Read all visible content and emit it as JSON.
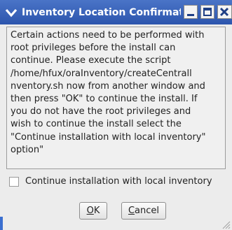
{
  "window": {
    "title": "Inventory Location Confirmatio"
  },
  "message": {
    "text": "Certain actions need to be performed with\nroot privileges before the install can\ncontinue. Please execute the script\n/home/hfux/oraInventory/createCentrall\nnventory.sh now from another window and\nthen press \"OK\" to continue the install. If\nyou do not have the root privileges and\nwish to continue the install select the\n\"Continue installation with local inventory\"\noption\""
  },
  "checkbox": {
    "label": "Continue installation with local inventory",
    "checked": false
  },
  "buttons": {
    "ok_mnemonic": "O",
    "ok_rest": "K",
    "cancel_mnemonic": "C",
    "cancel_rest": "ancel"
  },
  "icons": {
    "window_menu": "chevron-down-icon",
    "minimize": "minimize-icon",
    "maximize": "maximize-icon",
    "close": "close-icon",
    "resize": "resize-grip-icon"
  },
  "colors": {
    "titlebar": "#2c55ad",
    "accent": "#3b6fd0"
  }
}
